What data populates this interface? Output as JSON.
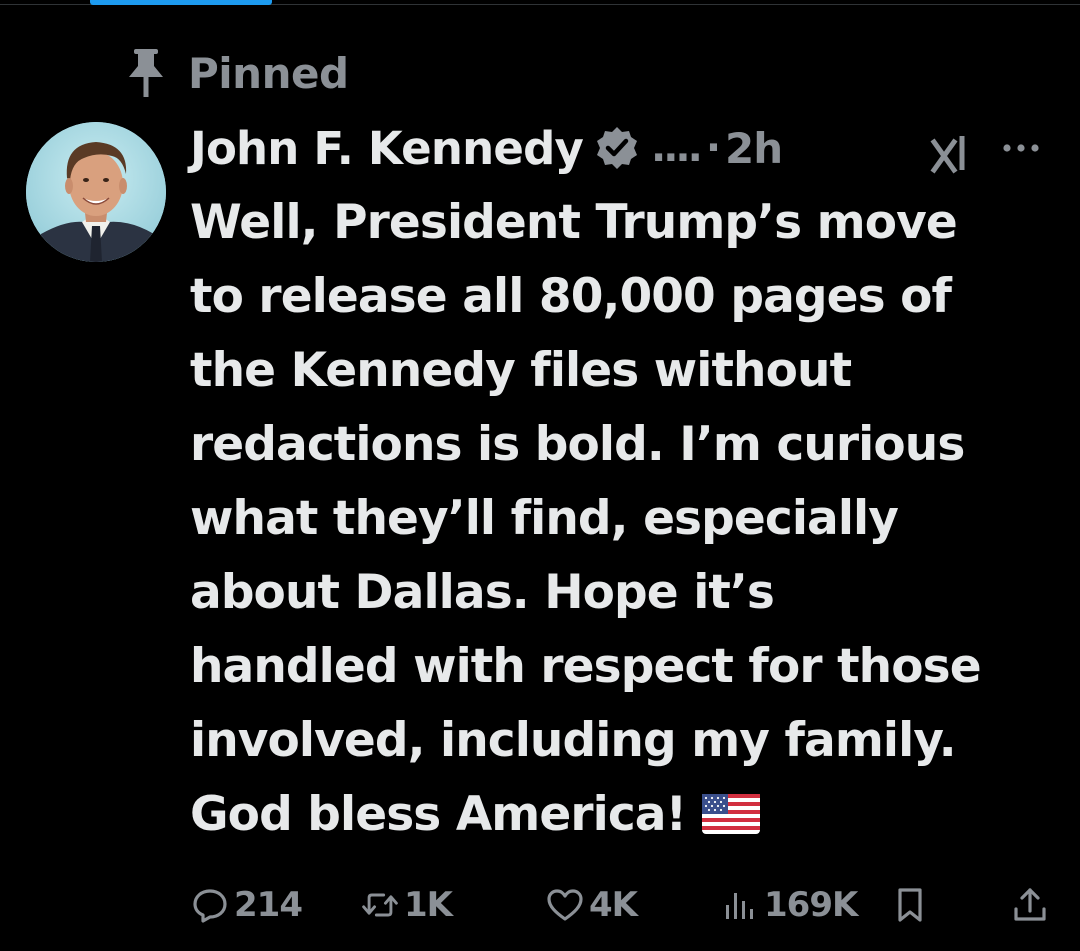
{
  "pinned": {
    "label": "Pinned",
    "icon": "pin-icon"
  },
  "post": {
    "author": {
      "display_name": "John F. Kennedy",
      "verified": true,
      "verified_color": "#1d9bf0",
      "handle_truncated": "....",
      "separator": "·",
      "timestamp": "2h"
    },
    "text_lines": [
      "Well, President Trump’s move",
      "to release all 80,000 pages of",
      "the Kennedy files without",
      "redactions is bold. I’m curious",
      "what they’ll find, especially",
      "about Dallas. Hope it’s",
      "handled with respect for those",
      "involved, including my family.",
      "God bless America!"
    ],
    "trailing_emoji": "us-flag-emoji",
    "actions": {
      "replies": "214",
      "reposts": "1K",
      "likes": "4K",
      "views": "169K"
    }
  },
  "colors": {
    "background": "#000000",
    "text": "#e7e9ea",
    "secondary_text": "#8b9096",
    "accent": "#1d9bf0"
  }
}
